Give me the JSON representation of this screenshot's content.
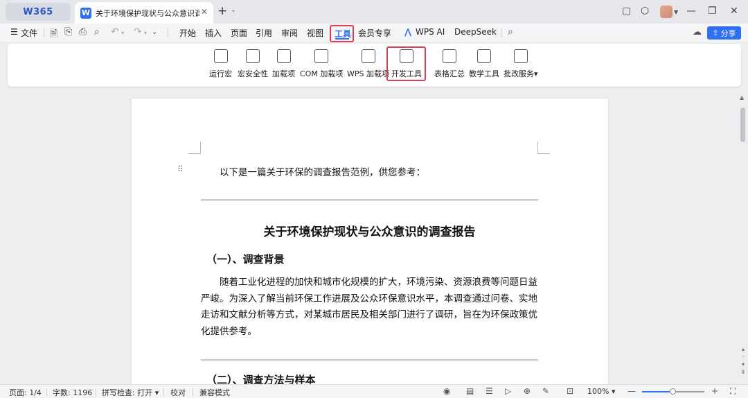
{
  "titlebar": {
    "brand": "W365",
    "doc_tab_title": "关于环境保护现状与公众意识调查",
    "doc_badge": "W",
    "close_glyph": "✕",
    "new_tab_glyph": "+",
    "window_icons": [
      "restore-icon",
      "cube-icon",
      "minimize-icon",
      "maximize-icon",
      "close-icon"
    ]
  },
  "menubar": {
    "hamburger": "☰",
    "file_label": "文件",
    "menus": [
      "开始",
      "插入",
      "页面",
      "引用",
      "审阅",
      "视图",
      "工具",
      "会员专享",
      "WPS AI",
      "DeepSeek"
    ],
    "active_menu": "工具",
    "share_label": "分享"
  },
  "ribbon": {
    "buttons": [
      "运行宏",
      "宏安全性",
      "加载项",
      "COM 加载项",
      "WPS 加载项",
      "开发工具",
      "表格汇总",
      "教学工具",
      "批改服务"
    ],
    "highlighted_button": "开发工具"
  },
  "document": {
    "intro": "以下是一篇关于环保的调查报告范例，供您参考：",
    "title": "关于环境保护现状与公众意识的调查报告",
    "section1_heading": "（一）、调查背景",
    "section1_body": "随着工业化进程的加快和城市化规模的扩大，环境污染、资源浪费等问题日益严峻。为深入了解当前环保工作进展及公众环保意识水平，本调查通过问卷、实地走访和文献分析等方式，对某城市居民及相关部门进行了调研，旨在为环保政策优化提供参考。",
    "section2_heading": "（二）、调查方法与样本"
  },
  "statusbar": {
    "page": "页面: 1/4",
    "word_count": "字数: 1196",
    "spell_check": "拼写检查: 打开",
    "proofread": "校对",
    "compat_mode": "兼容模式",
    "zoom": "100%",
    "zoom_fraction": 0.5
  },
  "colors": {
    "accent": "#2f6ff3",
    "highlight": "#e23b4f"
  }
}
